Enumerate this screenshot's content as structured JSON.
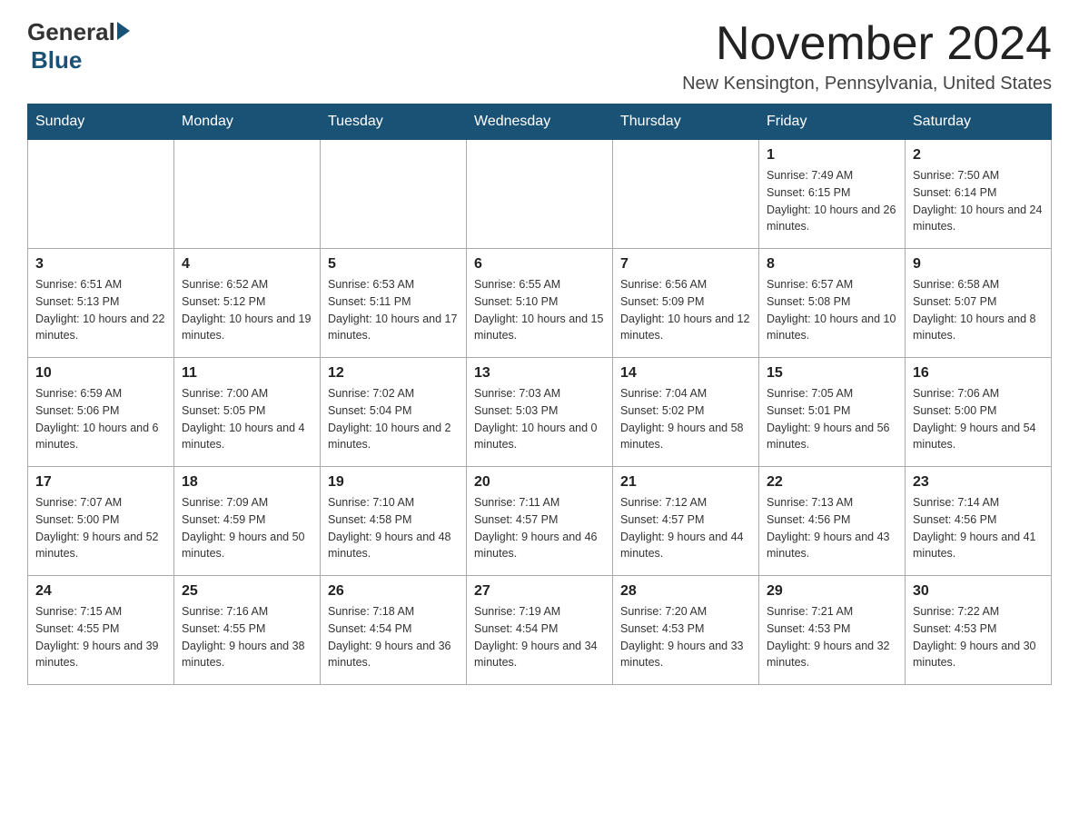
{
  "logo": {
    "general": "General",
    "blue": "Blue"
  },
  "title": "November 2024",
  "location": "New Kensington, Pennsylvania, United States",
  "days_of_week": [
    "Sunday",
    "Monday",
    "Tuesday",
    "Wednesday",
    "Thursday",
    "Friday",
    "Saturday"
  ],
  "weeks": [
    [
      {
        "day": "",
        "info": ""
      },
      {
        "day": "",
        "info": ""
      },
      {
        "day": "",
        "info": ""
      },
      {
        "day": "",
        "info": ""
      },
      {
        "day": "",
        "info": ""
      },
      {
        "day": "1",
        "info": "Sunrise: 7:49 AM\nSunset: 6:15 PM\nDaylight: 10 hours and 26 minutes."
      },
      {
        "day": "2",
        "info": "Sunrise: 7:50 AM\nSunset: 6:14 PM\nDaylight: 10 hours and 24 minutes."
      }
    ],
    [
      {
        "day": "3",
        "info": "Sunrise: 6:51 AM\nSunset: 5:13 PM\nDaylight: 10 hours and 22 minutes."
      },
      {
        "day": "4",
        "info": "Sunrise: 6:52 AM\nSunset: 5:12 PM\nDaylight: 10 hours and 19 minutes."
      },
      {
        "day": "5",
        "info": "Sunrise: 6:53 AM\nSunset: 5:11 PM\nDaylight: 10 hours and 17 minutes."
      },
      {
        "day": "6",
        "info": "Sunrise: 6:55 AM\nSunset: 5:10 PM\nDaylight: 10 hours and 15 minutes."
      },
      {
        "day": "7",
        "info": "Sunrise: 6:56 AM\nSunset: 5:09 PM\nDaylight: 10 hours and 12 minutes."
      },
      {
        "day": "8",
        "info": "Sunrise: 6:57 AM\nSunset: 5:08 PM\nDaylight: 10 hours and 10 minutes."
      },
      {
        "day": "9",
        "info": "Sunrise: 6:58 AM\nSunset: 5:07 PM\nDaylight: 10 hours and 8 minutes."
      }
    ],
    [
      {
        "day": "10",
        "info": "Sunrise: 6:59 AM\nSunset: 5:06 PM\nDaylight: 10 hours and 6 minutes."
      },
      {
        "day": "11",
        "info": "Sunrise: 7:00 AM\nSunset: 5:05 PM\nDaylight: 10 hours and 4 minutes."
      },
      {
        "day": "12",
        "info": "Sunrise: 7:02 AM\nSunset: 5:04 PM\nDaylight: 10 hours and 2 minutes."
      },
      {
        "day": "13",
        "info": "Sunrise: 7:03 AM\nSunset: 5:03 PM\nDaylight: 10 hours and 0 minutes."
      },
      {
        "day": "14",
        "info": "Sunrise: 7:04 AM\nSunset: 5:02 PM\nDaylight: 9 hours and 58 minutes."
      },
      {
        "day": "15",
        "info": "Sunrise: 7:05 AM\nSunset: 5:01 PM\nDaylight: 9 hours and 56 minutes."
      },
      {
        "day": "16",
        "info": "Sunrise: 7:06 AM\nSunset: 5:00 PM\nDaylight: 9 hours and 54 minutes."
      }
    ],
    [
      {
        "day": "17",
        "info": "Sunrise: 7:07 AM\nSunset: 5:00 PM\nDaylight: 9 hours and 52 minutes."
      },
      {
        "day": "18",
        "info": "Sunrise: 7:09 AM\nSunset: 4:59 PM\nDaylight: 9 hours and 50 minutes."
      },
      {
        "day": "19",
        "info": "Sunrise: 7:10 AM\nSunset: 4:58 PM\nDaylight: 9 hours and 48 minutes."
      },
      {
        "day": "20",
        "info": "Sunrise: 7:11 AM\nSunset: 4:57 PM\nDaylight: 9 hours and 46 minutes."
      },
      {
        "day": "21",
        "info": "Sunrise: 7:12 AM\nSunset: 4:57 PM\nDaylight: 9 hours and 44 minutes."
      },
      {
        "day": "22",
        "info": "Sunrise: 7:13 AM\nSunset: 4:56 PM\nDaylight: 9 hours and 43 minutes."
      },
      {
        "day": "23",
        "info": "Sunrise: 7:14 AM\nSunset: 4:56 PM\nDaylight: 9 hours and 41 minutes."
      }
    ],
    [
      {
        "day": "24",
        "info": "Sunrise: 7:15 AM\nSunset: 4:55 PM\nDaylight: 9 hours and 39 minutes."
      },
      {
        "day": "25",
        "info": "Sunrise: 7:16 AM\nSunset: 4:55 PM\nDaylight: 9 hours and 38 minutes."
      },
      {
        "day": "26",
        "info": "Sunrise: 7:18 AM\nSunset: 4:54 PM\nDaylight: 9 hours and 36 minutes."
      },
      {
        "day": "27",
        "info": "Sunrise: 7:19 AM\nSunset: 4:54 PM\nDaylight: 9 hours and 34 minutes."
      },
      {
        "day": "28",
        "info": "Sunrise: 7:20 AM\nSunset: 4:53 PM\nDaylight: 9 hours and 33 minutes."
      },
      {
        "day": "29",
        "info": "Sunrise: 7:21 AM\nSunset: 4:53 PM\nDaylight: 9 hours and 32 minutes."
      },
      {
        "day": "30",
        "info": "Sunrise: 7:22 AM\nSunset: 4:53 PM\nDaylight: 9 hours and 30 minutes."
      }
    ]
  ]
}
